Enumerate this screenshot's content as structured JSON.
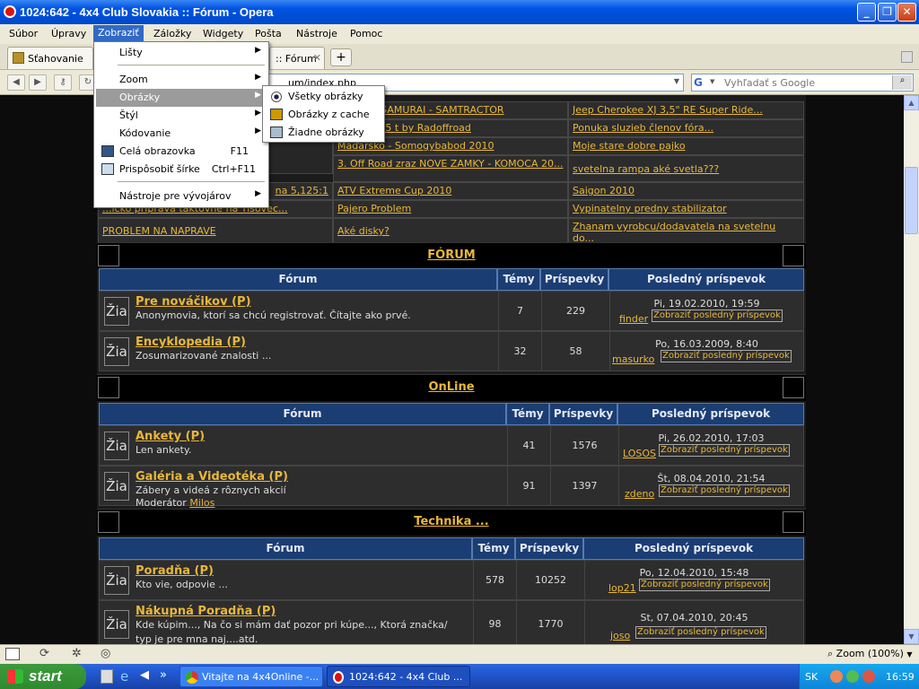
{
  "window": {
    "title": "1024:642 - 4x4 Club Slovakia :: Fórum - Opera"
  },
  "menubar": [
    "Súbor",
    "Úpravy",
    "Zobraziť",
    "Záložky",
    "Widgety",
    "Pošta",
    "Nástroje",
    "Pomoc"
  ],
  "tabs": [
    {
      "label": "Sťahovanie"
    },
    {
      "label": ":: Fórum",
      "close": "✕"
    }
  ],
  "address": {
    "url": "um/index.php",
    "search_placeholder": "Vyhľadať s Google"
  },
  "view_menu": [
    {
      "label": "Lišty",
      "arrow": "▶"
    },
    {
      "label": "Zoom",
      "arrow": "▶"
    },
    {
      "label": "Obrázky",
      "arrow": "▶"
    },
    {
      "label": "Štýl",
      "arrow": "▶"
    },
    {
      "label": "Kódovanie",
      "arrow": "▶"
    },
    {
      "label": "Celá obrazovka",
      "shortcut": "F11"
    },
    {
      "label": "Prispôsobiť šírke",
      "shortcut": "Ctrl+F11"
    },
    {
      "label": "Nástroje pre vývojárov",
      "arrow": "▶"
    }
  ],
  "images_menu": [
    {
      "label": "Všetky obrázky"
    },
    {
      "label": "Obrázky z cache"
    },
    {
      "label": "Žiadne obrázky"
    }
  ],
  "topics": [
    [
      "",
      "TEL MOJ SAMURAI - SAMTRACTOR",
      "Jeep Cherokee XJ 3,5\" RE Super Ride..."
    ],
    [
      "",
      "naviják 5,5 t by Radoffroad",
      "Ponuka sluzieb členov fóra..."
    ],
    [
      "",
      "Maďarsko - Somogybabod 2010",
      "Moje stare dobre pajko"
    ],
    [
      "",
      "3. Off Road zraz NOVE ZAMKY - KOMOCA 20...",
      "svetelna rampa aké svetla???"
    ],
    [
      "na 5,125:1",
      "ATV Extreme Cup 2010",
      "Saigon 2010"
    ],
    [
      "...ičko príprava taktovne na Tisovec...",
      "Pajero Problem",
      "Vypinatelny predny stabilizator"
    ],
    [
      "PROBLEM NA NAPRAVE",
      "Aké disky?",
      "Zhanam vyrobcu/dodavatela na svetelnu do..."
    ]
  ],
  "headers": {
    "forum": "Fórum",
    "topics": "Témy",
    "posts": "Príspevky",
    "last": "Posledný príspevok",
    "view_last": "Zobraziť posledný príspevok",
    "icon": "Žia"
  },
  "categories": [
    {
      "title": "FÓRUM",
      "forums": [
        {
          "name": "Pre nováčikov (P)",
          "desc": "Anonymovia, ktorí sa chcú registrovať. Čítajte ako prvé.",
          "topics": "7",
          "posts": "229",
          "date": "Pi, 19.02.2010, 19:59",
          "user": "finder"
        },
        {
          "name": "Encyklopedia (P)",
          "desc": "Zosumarizované znalosti ...",
          "topics": "32",
          "posts": "58",
          "date": "Po, 16.03.2009, 8:40",
          "user": "masurko"
        }
      ]
    },
    {
      "title": "OnLine",
      "forums": [
        {
          "name": "Ankety (P)",
          "desc": "Len ankety.",
          "topics": "41",
          "posts": "1576",
          "date": "Pi, 26.02.2010, 17:03",
          "user": "LOSOS"
        },
        {
          "name": "Galéria a Videotéka (P)",
          "desc": "Zábery a videá z rôznych akcií",
          "mod_label": "Moderátor",
          "mod": "Milos",
          "topics": "91",
          "posts": "1397",
          "date": "Št, 08.04.2010, 21:54",
          "user": "zdeno"
        }
      ]
    },
    {
      "title": "Technika ...",
      "forums": [
        {
          "name": "Poradňa (P)",
          "desc": "Kto vie, odpovie ...",
          "topics": "578",
          "posts": "10252",
          "date": "Po, 12.04.2010, 15:48",
          "user": "lop21"
        },
        {
          "name": "Nákupná Poradňa (P)",
          "desc": "Kde kúpim..., Na čo si mám dať pozor pri kúpe..., Ktorá značka/",
          "desc2": "typ je pre mna naj....atd.",
          "topics": "98",
          "posts": "1770",
          "date": "St, 07.04.2010, 20:45",
          "user": "joso"
        }
      ]
    }
  ],
  "status": {
    "zoom": "Zoom (100%)"
  },
  "taskbar": {
    "start": "start",
    "tasks": [
      "Vitajte na 4x4Online -...",
      "1024:642 - 4x4 Club ..."
    ],
    "lang": "SK",
    "clock": "16:59"
  },
  "colors": {
    "link": "#e9b73a",
    "header": "#1a3d73",
    "menu_highlight": "#9b9b9b"
  }
}
